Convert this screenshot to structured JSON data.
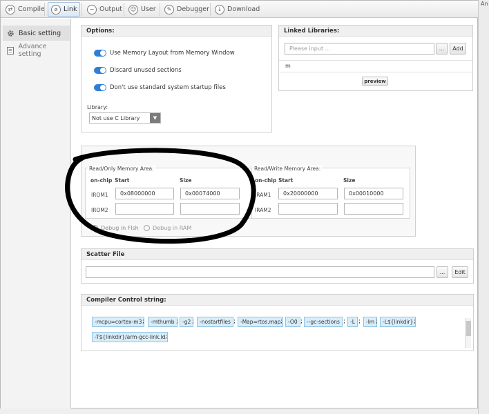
{
  "toolbar": {
    "tabs": [
      {
        "label": "Compile",
        "icon": "compile-icon"
      },
      {
        "label": "Link",
        "icon": "link-icon",
        "active": true
      },
      {
        "label": "Output",
        "icon": "output-icon"
      },
      {
        "label": "User",
        "icon": "user-icon"
      },
      {
        "label": "Debugger",
        "icon": "debugger-icon"
      },
      {
        "label": "Download",
        "icon": "download-icon"
      }
    ]
  },
  "right_strip_text": "An",
  "sidebar": {
    "items": [
      {
        "label": "Basic setting",
        "icon": "gear-icon",
        "active": true
      },
      {
        "label": "Advance setting",
        "icon": "document-icon",
        "active": false
      }
    ]
  },
  "options": {
    "title": "Options:",
    "checks": [
      "Use Memory Layout from Memory Window",
      "Discard unused sections",
      "Don't use standard system startup files"
    ],
    "library_label": "Library:",
    "library_value": "Not use C Library"
  },
  "linked_libraries": {
    "title": "Linked Libraries:",
    "input_placeholder": "Please input ...",
    "browse_label": "...",
    "add_label": "Add",
    "item": "m",
    "preview_label": "preview"
  },
  "memory": {
    "ro": {
      "title": "Read/Only Memory Area:",
      "col_onchip": "on-chip",
      "col_start": "Start",
      "col_size": "Size",
      "rows": [
        {
          "name": "IROM1",
          "start": "0x08000000",
          "size": "0x00074000"
        },
        {
          "name": "IROM2",
          "start": "",
          "size": ""
        }
      ]
    },
    "rw": {
      "title": "Read/Write Memory Area:",
      "col_onchip": "on-chip",
      "col_start": "Start",
      "col_size": "Size",
      "rows": [
        {
          "name": "IRAM1",
          "start": "0x20000000",
          "size": "0x00010000"
        },
        {
          "name": "IRAM2",
          "start": "",
          "size": ""
        }
      ]
    },
    "debug_options": [
      "Debug in Flsh",
      "Debug in RAM"
    ]
  },
  "scatter": {
    "title": "Scatter File",
    "value": "",
    "browse_label": "...",
    "edit_label": "Edit"
  },
  "compiler": {
    "title": "Compiler Control string:",
    "tags_row1": [
      "-mcpu=cortex-m3",
      "-mthumb",
      "-g2",
      "-nostartfiles",
      "-Map=rtos.map",
      "-O0",
      "--gc-sections",
      "-L",
      "-lm",
      "-L${linkdir}"
    ],
    "tags_row2": [
      "-T${linkdir}/arm-gcc-link.ld"
    ],
    "separator": ";"
  },
  "colors": {
    "accent": "#2f7fd8",
    "tag_bg": "#d9edf9",
    "annotation": "#000000"
  }
}
